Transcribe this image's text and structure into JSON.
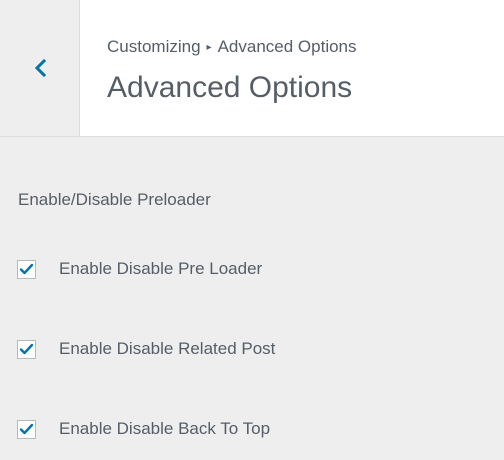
{
  "header": {
    "breadcrumb_parent": "Customizing",
    "breadcrumb_separator": "▸",
    "breadcrumb_current": "Advanced Options",
    "title": "Advanced Options",
    "back_icon": "chevron-left-icon"
  },
  "section": {
    "title": "Enable/Disable Preloader"
  },
  "options": [
    {
      "label": "Enable Disable Pre Loader",
      "checked": true
    },
    {
      "label": "Enable Disable Related Post",
      "checked": true
    },
    {
      "label": "Enable Disable Back To Top",
      "checked": true
    }
  ],
  "colors": {
    "accent": "#0073aa",
    "text": "#555d66",
    "panel_background": "#eeeeee",
    "header_background": "#ffffff",
    "border": "#dddddd"
  }
}
